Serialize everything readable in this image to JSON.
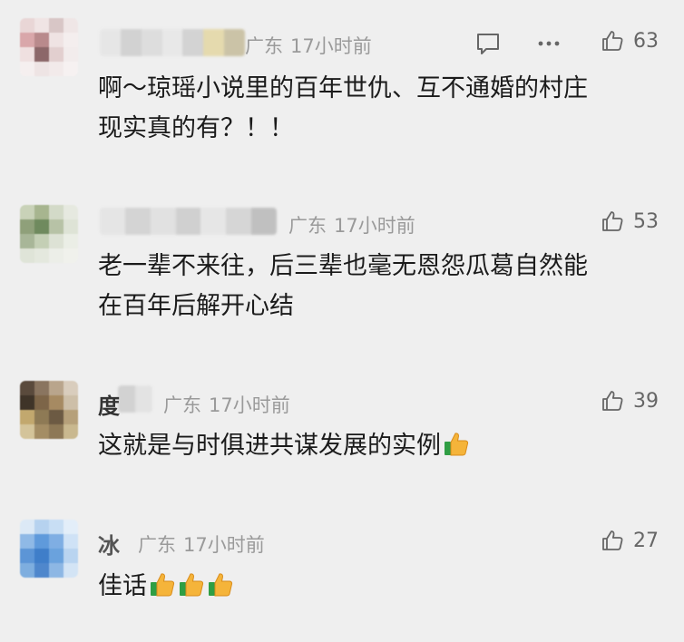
{
  "comments": [
    {
      "location": "广东",
      "time": "17小时前",
      "likes": "63",
      "text_lines": [
        "啊～琼瑶小说里的百年世仇、互不通婚的村庄",
        "现实真的有？！！"
      ],
      "emoji_count": 0
    },
    {
      "location": "广东",
      "time": "17小时前",
      "likes": "53",
      "text_lines": [
        "老一辈不来往，后三辈也毫无恩怨瓜葛自然能",
        "在百年后解开心结"
      ],
      "emoji_count": 0
    },
    {
      "nickname_fragment": "度",
      "location": "广东",
      "time": "17小时前",
      "likes": "39",
      "text_lines": [
        "这就是与时俱进共谋发展的实例"
      ],
      "emoji_count": 1
    },
    {
      "nickname_fragment": "冰",
      "location": "广东",
      "time": "17小时前",
      "likes": "27",
      "text_lines": [
        "佳话"
      ],
      "emoji_count": 3
    }
  ],
  "icons": {
    "comment": "comment-bubble-icon",
    "more": "more-dots-icon",
    "like": "thumbs-up-outline-icon",
    "emoji": "thumbs-up-emoji"
  },
  "colors": {
    "background": "#efefef",
    "meta_text": "#9a9a9a",
    "body_text": "#1b1b1b",
    "like_count": "#666666"
  }
}
